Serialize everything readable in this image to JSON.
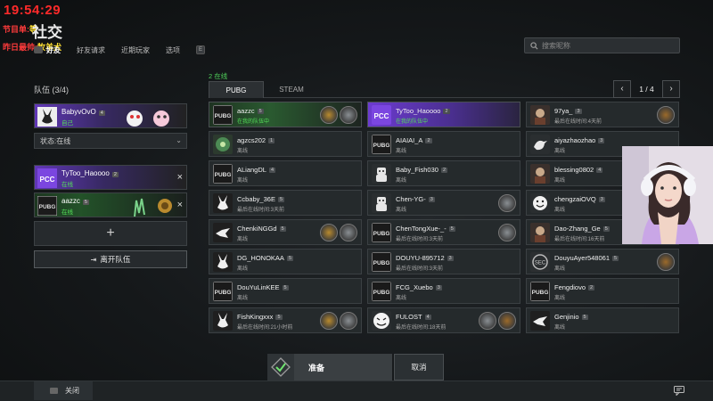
{
  "overlay": {
    "clock": "19:54:29",
    "program_label": "节目单:",
    "program_value": "等",
    "yesterday_label": "昨日最帅:",
    "yesterday_value": "牧羊犬"
  },
  "page_title": "社交",
  "nav_tabs": [
    {
      "label": "好友",
      "active": true
    },
    {
      "label": "好友请求",
      "active": false
    },
    {
      "label": "近期玩家",
      "active": false
    },
    {
      "label": "选项",
      "active": false
    }
  ],
  "nav_badge": "E",
  "search": {
    "placeholder": "搜索昵称"
  },
  "party": {
    "title": "队伍 (3/4)",
    "leader": {
      "name": "BabyvOvO",
      "level": "4",
      "status": "自己"
    },
    "status_select": "状态:在线",
    "members": [
      {
        "name": "TyToo_Haoooo",
        "level": "2",
        "status": "在线"
      },
      {
        "name": "aazzc",
        "level": "5",
        "status": "在线"
      }
    ],
    "add_label": "+",
    "leave_label": "离开队伍"
  },
  "friends": {
    "online_count": "2 在线",
    "platform_tabs": [
      "PUBG",
      "STEAM"
    ],
    "page": "1 / 4",
    "prev": "‹",
    "next": "›",
    "list": [
      {
        "name": "aazzc",
        "level": "5",
        "status": "在我的队伍中",
        "online": true,
        "avatar": "pubg",
        "badges": 2,
        "banner": "green"
      },
      {
        "name": "TyToo_Haoooo",
        "level": "2",
        "status": "在我的队伍中",
        "online": true,
        "avatar": "pcc",
        "badges": 0,
        "banner": "purple"
      },
      {
        "name": "97ya_",
        "level": "3",
        "status": "最后在线时间:4天前",
        "online": false,
        "avatar": "char",
        "badges": 1,
        "banner": ""
      },
      {
        "name": "agzcs202",
        "level": "1",
        "status": "离线",
        "online": false,
        "avatar": "green",
        "badges": 0,
        "banner": ""
      },
      {
        "name": "AIAIAI_A",
        "level": "2",
        "status": "离线",
        "online": false,
        "avatar": "pubg",
        "badges": 0,
        "banner": ""
      },
      {
        "name": "aiyazhaozhao",
        "level": "3",
        "status": "离线",
        "online": false,
        "avatar": "bird",
        "badges": 0,
        "banner": ""
      },
      {
        "name": "ALiangDL",
        "level": "4",
        "status": "离线",
        "online": false,
        "avatar": "pubg",
        "badges": 0,
        "banner": ""
      },
      {
        "name": "Baby_Fish030",
        "level": "2",
        "status": "离线",
        "online": false,
        "avatar": "robot",
        "badges": 0,
        "banner": ""
      },
      {
        "name": "blessing0802",
        "level": "4",
        "status": "离线",
        "online": false,
        "avatar": "char",
        "badges": 0,
        "banner": ""
      },
      {
        "name": "Ccbaby_36E",
        "level": "5",
        "status": "最后在线时间:3天前",
        "online": false,
        "avatar": "rabbit",
        "badges": 0,
        "banner": ""
      },
      {
        "name": "Chen-YG-",
        "level": "3",
        "status": "离线",
        "online": false,
        "avatar": "robot",
        "badges": 1,
        "banner": ""
      },
      {
        "name": "chengzaiOVQ",
        "level": "3",
        "status": "离线",
        "online": false,
        "avatar": "smile",
        "badges": 0,
        "banner": ""
      },
      {
        "name": "ChenkiNGGd",
        "level": "5",
        "status": "离线",
        "online": false,
        "avatar": "crow",
        "badges": 2,
        "banner": ""
      },
      {
        "name": "ChenTongXue-_-",
        "level": "5",
        "status": "最后在线时间:3天前",
        "online": false,
        "avatar": "pubg",
        "badges": 1,
        "banner": ""
      },
      {
        "name": "Dao-Zhang_Ge",
        "level": "5",
        "status": "最后在线时间:16天前",
        "online": false,
        "avatar": "char",
        "badges": 0,
        "banner": ""
      },
      {
        "name": "DG_HONOKAA",
        "level": "5",
        "status": "离线",
        "online": false,
        "avatar": "rabbit",
        "badges": 0,
        "banner": ""
      },
      {
        "name": "DOUYU-895712",
        "level": "3",
        "status": "最后在线时间:3天前",
        "online": false,
        "avatar": "pubg",
        "badges": 0,
        "banner": ""
      },
      {
        "name": "DouyuAyer548061",
        "level": "5",
        "status": "离线",
        "online": false,
        "avatar": "gray",
        "badges": 1,
        "banner": ""
      },
      {
        "name": "DouYuLinKEE",
        "level": "5",
        "status": "离线",
        "online": false,
        "avatar": "pubg",
        "badges": 0,
        "banner": ""
      },
      {
        "name": "FCG_Xuebo",
        "level": "3",
        "status": "离线",
        "online": false,
        "avatar": "pubg",
        "badges": 0,
        "banner": ""
      },
      {
        "name": "Fengdiovo",
        "level": "2",
        "status": "离线",
        "online": false,
        "avatar": "pubg",
        "badges": 0,
        "banner": ""
      },
      {
        "name": "FishKingxxx",
        "level": "5",
        "status": "最后在线时间:21小时前",
        "online": false,
        "avatar": "rabbit",
        "badges": 2,
        "banner": ""
      },
      {
        "name": "FULOST",
        "level": "4",
        "status": "最后在线时间:18天前",
        "online": false,
        "avatar": "face",
        "badges": 2,
        "banner": ""
      },
      {
        "name": "Genjinio",
        "level": "5",
        "status": "离线",
        "online": false,
        "avatar": "crow",
        "badges": 0,
        "banner": ""
      }
    ]
  },
  "ready_label": "准备",
  "cancel_label": "取消",
  "close_label": "关闭",
  "colors": {
    "accent_green": "#55e05a",
    "clock_red": "#ff2a2a",
    "overlay_yellow": "#ffe033",
    "party_purple": "#6d3bd1"
  }
}
